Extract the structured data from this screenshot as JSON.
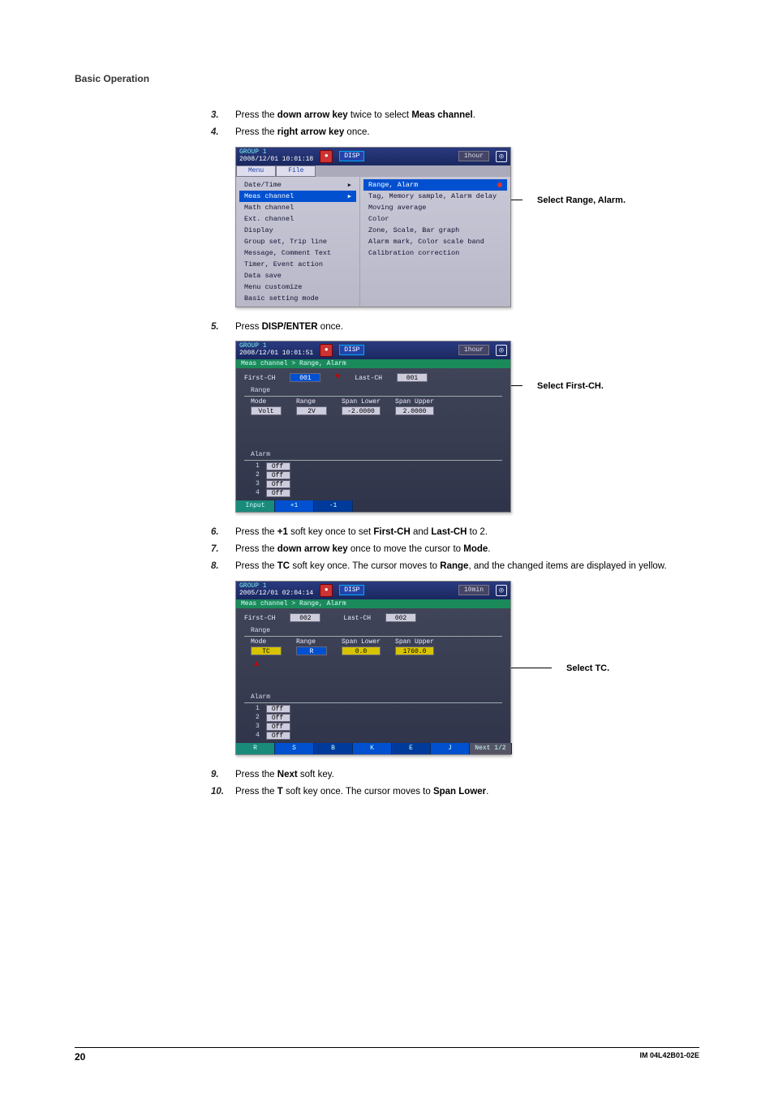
{
  "header": {
    "title": "Basic Operation"
  },
  "steps": {
    "s3": {
      "num": "3.",
      "pre": "Press the ",
      "b1": "down arrow key",
      "mid": " twice to select ",
      "b2": "Meas channel",
      "post": "."
    },
    "s4": {
      "num": "4.",
      "pre": "Press the ",
      "b1": "right arrow key",
      "post": " once."
    },
    "s5": {
      "num": "5.",
      "pre": "Press ",
      "b1": "DISP/ENTER",
      "post": " once."
    },
    "s6": {
      "num": "6.",
      "pre": "Press the ",
      "b1": "+1",
      "mid": " soft key once to set ",
      "b2": "First-CH",
      "mid2": " and ",
      "b3": "Last-CH",
      "post": " to 2."
    },
    "s7": {
      "num": "7.",
      "pre": "Press the ",
      "b1": "down arrow key",
      "mid": " once to move the cursor to ",
      "b2": "Mode",
      "post": "."
    },
    "s8": {
      "num": "8.",
      "pre": "Press the ",
      "b1": "TC",
      "mid": " soft key once. The cursor moves to ",
      "b2": "Range",
      "post": ", and the changed items are displayed in yellow."
    },
    "s9": {
      "num": "9.",
      "pre": "Press the ",
      "b1": "Next",
      "post": " soft key."
    },
    "s10": {
      "num": "10.",
      "pre": "Press the ",
      "b1": "T",
      "mid": " soft key once. The cursor moves to ",
      "b2": "Span Lower",
      "post": "."
    }
  },
  "callouts": {
    "c1": "Select Range, Alarm.",
    "c2": "Select First-CH.",
    "c3": "Select TC."
  },
  "shot1": {
    "group": "GROUP 1",
    "ts": "2008/12/01 10:01:18",
    "disp": "DISP",
    "dur": "1hour",
    "tabs": {
      "t1": "Menu",
      "t2": "File"
    },
    "menu": [
      "Date/Time",
      "Meas channel",
      "Math channel",
      "Ext. channel",
      "Display",
      "Group set, Trip line",
      "Message, Comment Text",
      "Timer, Event action",
      "Data save",
      "Menu customize",
      "Basic setting mode"
    ],
    "submenu": [
      "Range, Alarm",
      "Tag, Memory sample, Alarm delay",
      "Moving average",
      "Color",
      "Zone, Scale, Bar graph",
      "Alarm mark, Color scale band",
      "Calibration correction"
    ],
    "arrow": "▶"
  },
  "shot2": {
    "group": "GROUP 1",
    "ts": "2008/12/01 10:01:51",
    "disp": "DISP",
    "dur": "1hour",
    "breadcrumb": "Meas channel > Range, Alarm",
    "first_lbl": "First-CH",
    "first_val": "001",
    "last_lbl": "Last-CH",
    "last_val": "001",
    "range_lbl": "Range",
    "mode_lbl": "Mode",
    "mode_val": "Volt",
    "rng_lbl": "Range",
    "rng_val": "2V",
    "slo_lbl": "Span Lower",
    "slo_val": "-2.0000",
    "sup_lbl": "Span Upper",
    "sup_val": "2.0000",
    "alarm_lbl": "Alarm",
    "alarms": [
      {
        "i": "1",
        "v": "Off"
      },
      {
        "i": "2",
        "v": "Off"
      },
      {
        "i": "3",
        "v": "Off"
      },
      {
        "i": "4",
        "v": "Off"
      }
    ],
    "softkeys": [
      "Input",
      "+1",
      "-1"
    ]
  },
  "shot3": {
    "group": "GROUP 1",
    "ts": "2005/12/01 02:04:14",
    "disp": "DISP",
    "dur": "10min",
    "breadcrumb": "Meas channel > Range, Alarm",
    "first_lbl": "First-CH",
    "first_val": "002",
    "last_lbl": "Last-CH",
    "last_val": "002",
    "range_lbl": "Range",
    "mode_lbl": "Mode",
    "mode_val": "TC",
    "rng_lbl": "Range",
    "rng_val": "R",
    "slo_lbl": "Span Lower",
    "slo_val": "0.0",
    "sup_lbl": "Span Upper",
    "sup_val": "1760.0",
    "alarm_lbl": "Alarm",
    "alarms": [
      {
        "i": "1",
        "v": "Off"
      },
      {
        "i": "2",
        "v": "Off"
      },
      {
        "i": "3",
        "v": "Off"
      },
      {
        "i": "4",
        "v": "Off"
      }
    ],
    "softkeys": [
      "R",
      "S",
      "B",
      "K",
      "E",
      "J",
      "Next 1/2"
    ]
  },
  "footer": {
    "page": "20",
    "doc": "IM 04L42B01-02E"
  }
}
